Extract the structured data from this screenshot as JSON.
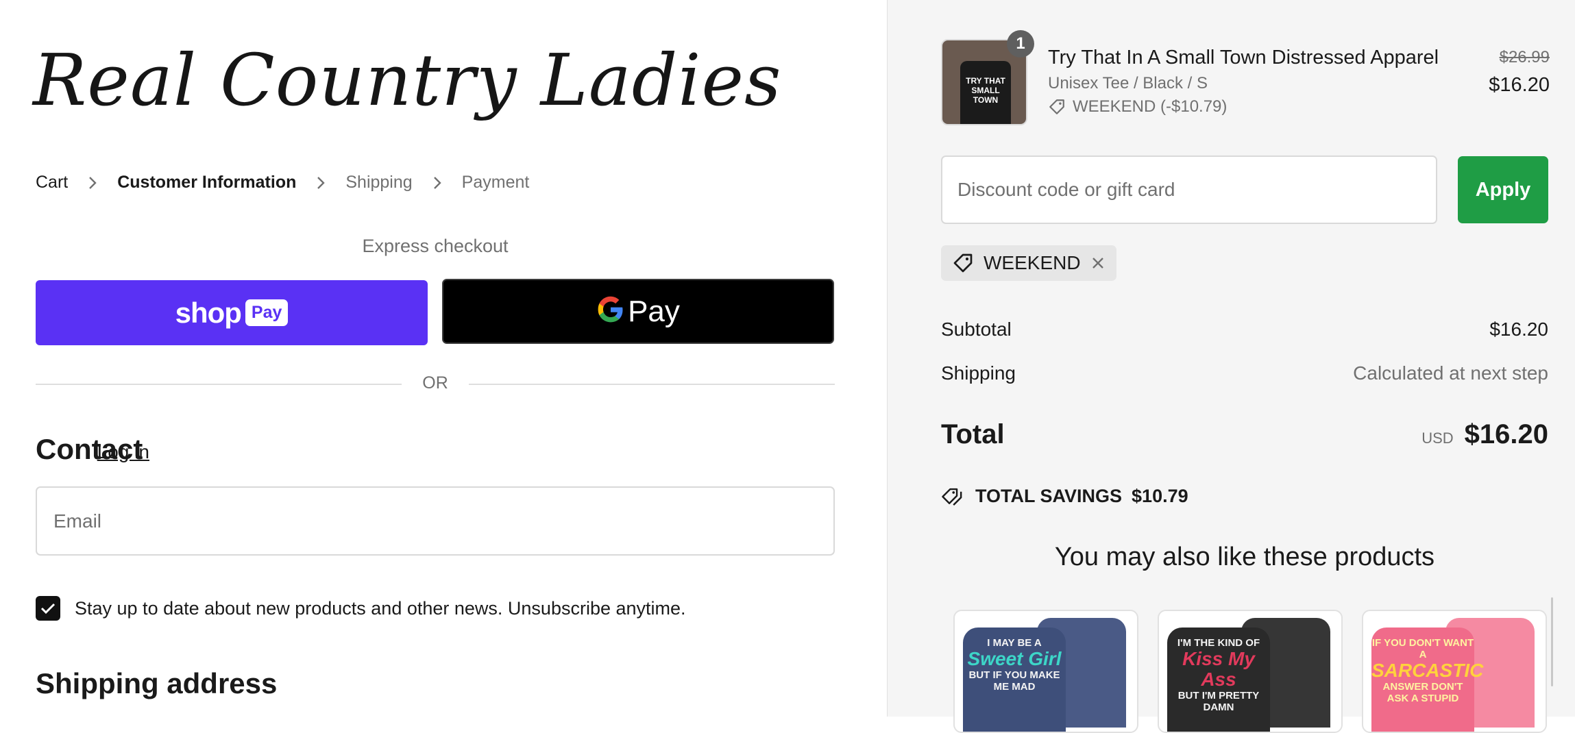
{
  "brand": {
    "name": "Real Country Ladies"
  },
  "breadcrumb": {
    "cart": "Cart",
    "customer_info": "Customer Information",
    "shipping": "Shipping",
    "payment": "Payment"
  },
  "express": {
    "title": "Express checkout",
    "shoppay_word": "shop",
    "shoppay_badge": "Pay",
    "gpay_label": "Pay"
  },
  "divider": {
    "or": "OR"
  },
  "contact": {
    "title": "Contact",
    "login": "Log in",
    "email_placeholder": "Email"
  },
  "newsletter": {
    "checked": true,
    "label": "Stay up to date about new products and other news. Unsubscribe anytime."
  },
  "shipping_address": {
    "title": "Shipping address"
  },
  "order": {
    "item": {
      "quantity": "1",
      "name": "Try That In A Small Town Distressed Apparel",
      "variant": "Unisex Tee / Black / S",
      "discount": "WEEKEND (-$10.79)",
      "price_original": "$26.99",
      "price_final": "$16.20",
      "image_text": "TRY THAT SMALL TOWN"
    },
    "discount_placeholder": "Discount code or gift card",
    "apply_label": "Apply",
    "applied_code": "WEEKEND",
    "subtotal_label": "Subtotal",
    "subtotal_value": "$16.20",
    "shipping_label": "Shipping",
    "shipping_value": "Calculated at next step",
    "total_label": "Total",
    "currency": "USD",
    "total_value": "$16.20",
    "savings_label": "TOTAL SAVINGS",
    "savings_value": "$10.79"
  },
  "recommendations": {
    "title": "You may also like these products",
    "items": [
      {
        "text_top": "I MAY BE A",
        "text_big": "Sweet Girl",
        "text_bottom": "BUT IF YOU MAKE ME MAD",
        "color": "#3e4f7a"
      },
      {
        "text_top": "I'M THE KIND OF",
        "text_big": "Kiss My Ass",
        "text_bottom": "BUT I'M PRETTY DAMN",
        "color": "#2a2a2a"
      },
      {
        "text_top": "IF YOU DON'T WANT A",
        "text_big": "SARCASTIC",
        "text_bottom": "ANSWER DON'T ASK A STUPID",
        "color": "#f06b8a"
      }
    ]
  },
  "colors": {
    "shoppay": "#5a31f4",
    "apply": "#1f9d45",
    "panel_bg": "#f5f5f5"
  },
  "icons": [
    "chevron-right-icon",
    "google-g-icon",
    "checkmark-icon",
    "tag-icon",
    "close-icon",
    "savings-tag-icon"
  ]
}
